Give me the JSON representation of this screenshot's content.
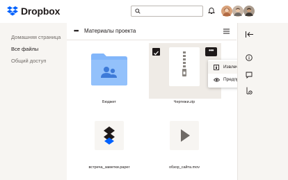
{
  "brand": {
    "name": "Dropbox"
  },
  "header": {
    "search_placeholder": "",
    "notification_icon": "bell-icon",
    "avatars": [
      {
        "name": "avatar-1",
        "color": "#c98a5a"
      },
      {
        "name": "avatar-2",
        "color": "#8a6a52"
      },
      {
        "name": "avatar-3",
        "color": "#5e4a40"
      }
    ]
  },
  "sidebar": {
    "items": [
      {
        "label": "Домашняя страница",
        "active": false
      },
      {
        "label": "Все файлы",
        "active": true
      },
      {
        "label": "Общий доступ",
        "active": false
      }
    ]
  },
  "main": {
    "folder_title": "Материалы проекта",
    "files": [
      {
        "name": "Бюджет",
        "kind": "folder",
        "icon": "shared-folder-icon"
      },
      {
        "name": "Чертежи.zip",
        "kind": "zip",
        "icon": "zip-file-icon",
        "selected": true
      },
      {
        "name": "встреча_заметки.paper",
        "kind": "paper",
        "icon": "dropbox-paper-icon"
      },
      {
        "name": "обзор_сайта.mov",
        "kind": "video",
        "icon": "play-icon"
      }
    ]
  },
  "context_menu": {
    "items": [
      {
        "label": "Извлечь все",
        "icon": "extract-icon",
        "hovered": true
      },
      {
        "label": "Предпросмотр",
        "icon": "eye-icon",
        "hovered": false
      }
    ]
  },
  "right_panel": {
    "icons": [
      "collapse-left-icon",
      "info-icon",
      "comment-icon",
      "activity-icon"
    ]
  },
  "colors": {
    "accent": "#0061fe",
    "folder": "#82b6fa",
    "sidebar_bg": "#f7f5f2",
    "text": "#1e1919"
  }
}
